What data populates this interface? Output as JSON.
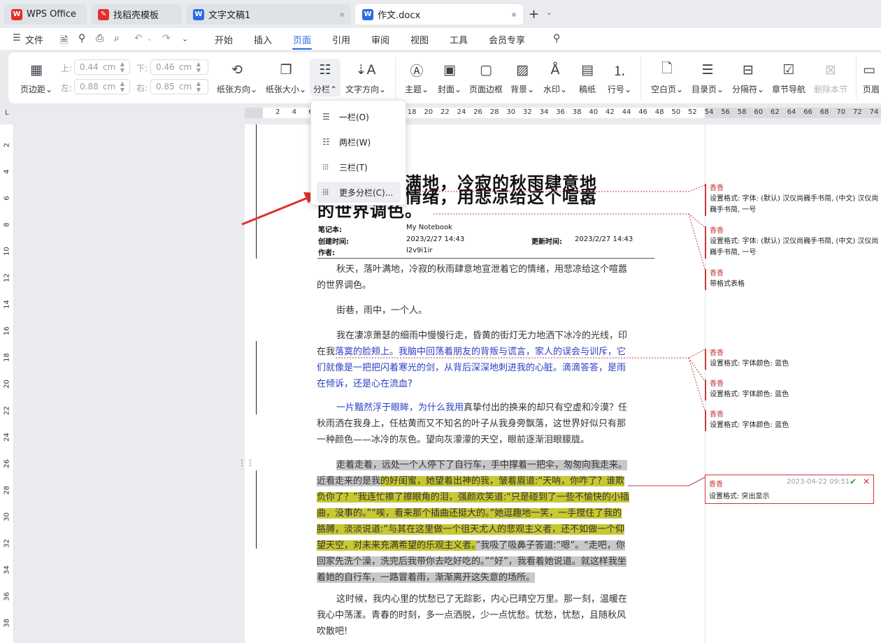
{
  "tabs": [
    {
      "label": "WPS Office",
      "icon": "wps-logo-icon",
      "color": "#e0302a"
    },
    {
      "label": "找稻壳模板",
      "icon": "docer-logo-icon",
      "color": "#e0302a"
    },
    {
      "label": "文字文稿1",
      "icon": "writer-doc-icon",
      "color": "#2b6be6"
    },
    {
      "label": "作文.docx",
      "icon": "writer-doc-icon",
      "color": "#2b6be6"
    }
  ],
  "menu": {
    "file": "文件",
    "items": [
      "开始",
      "插入",
      "页面",
      "引用",
      "审阅",
      "视图",
      "工具",
      "会员专享"
    ],
    "active": "页面"
  },
  "ribbon": {
    "margins": "页边距",
    "top_label": "上:",
    "top_value": "0.44",
    "bottom_label": "下:",
    "bottom_value": "0.46",
    "left_label": "左:",
    "left_value": "0.88",
    "right_label": "右:",
    "right_value": "0.85",
    "unit": "cm",
    "orientation": "纸张方向",
    "size": "纸张大小",
    "columns": "分栏",
    "text_direction": "文字方向",
    "theme": "主题",
    "cover": "封面",
    "border": "页面边框",
    "background": "背景",
    "watermark": "水印",
    "manuscript": "稿纸",
    "line_numbers": "行号",
    "blank_page": "空白页",
    "toc_page": "目录页",
    "separator": "分隔符",
    "section_nav": "章节导航",
    "delete_section": "删除本节",
    "header_footer": "页眉"
  },
  "ruler": {
    "h": [
      "2",
      "4",
      "6",
      "8",
      "10",
      "12",
      "14",
      "16",
      "18",
      "20",
      "22",
      "24",
      "26",
      "28",
      "30",
      "32",
      "34",
      "36",
      "38",
      "40",
      "42",
      "44",
      "46",
      "48",
      "50",
      "52",
      "54",
      "56",
      "58",
      "60",
      "62",
      "64",
      "66",
      "68",
      "70",
      "72",
      "74"
    ],
    "v": [
      "2",
      "4",
      "6",
      "8",
      "10",
      "12",
      "14",
      "16",
      "18",
      "20",
      "22",
      "24",
      "26",
      "28",
      "30",
      "32",
      "34",
      "36",
      "38"
    ]
  },
  "dropdown": {
    "items": [
      "一栏(O)",
      "两栏(W)",
      "三栏(T)",
      "更多分栏(C)..."
    ]
  },
  "doc": {
    "title_line1": "秋天，落叶满地，冷寂的秋雨肆意地",
    "title_line2": "宣泄着它的情绪，用悲凉给这个喧嚣",
    "title_line3": "的世界调色。",
    "meta": {
      "notebook_label": "笔记本:",
      "notebook": "My Notebook",
      "created_label": "创建时间:",
      "created": "2023/2/27 14:43",
      "updated_label": "更新时间:",
      "updated": "2023/2/27 14:43",
      "author_label": "作者:",
      "author": "l2v9i1ir"
    },
    "p1": "秋天，落叶满地，冷寂的秋雨肆意地宣泄着它的情绪，用悲凉给这个喧嚣的世界调色。",
    "p2": "街巷，雨中，一个人。",
    "p3a": "我在凄凉萧瑟的细雨中慢慢行走，昏黄的街灯无力地洒下冰冷的光线，印在我",
    "p3b": "落寞的脸颊上。我脑中回荡着朋友的背叛与谎言，家人的误会与训斥，它们就像是一把把闪着寒光的剑，从背后深深地刺进我的心脏。滴滴答答，是雨在倾诉，还是心在流血?",
    "p4a": "一片黯然浮于眼眸，为什么我用",
    "p4b": "真挚付出的换来的却只有空虚和冷漠？任秋雨洒在我身上，任枯黄而又不知名的叶子从我身旁飘落，这世界好似只有那一种颜色——冰冷的灰色。望向灰濛濛的天空，眼前逐渐泪眼朦胧。",
    "p5a": "走着走着，远处一个人停下了自行车，手中撑着一把伞，匆匆向我走来。近看走来的是我",
    "p5b": "的好闺蜜，她望着出神的我，皱着眉道:“天呐，你咋了？谁欺负你了？”我连忙擦了擦眼角的泪，强颜欢笑道:“只是碰到了一些不愉快的小插曲，没事的。”“唉，看来那个插曲还挺大的。”她逗趣地一笑，一手搅住了我的胳膊，淡淡说道:“与其在这里做一个徂天尤人的悲观主义者，还不如做一个仰望天空，对未来充满希望的乐观主义者。",
    "p5c": "”我吸了吸鼻子答道:“嗯”。“走吧，你回家先洗个澡，洗完后我带你去吃好吃的。”“好”，我看着她说道。就这样我坐着她的自行车，一路冒着雨，渐渐离开这失意的场所。",
    "p6": "这时候，我内心里的忧愁已了无踪影，内心已晴空万里。那一刻，温暖在我心中荡漾。青春的时刻，多一点洒脱，少一点忧愁。忧愁，忧愁，且随秋风吹散吧!"
  },
  "comments": [
    {
      "author": "香香",
      "text": "设置格式: 字体: (默认) 汉仪尚巍手书简, (中文) 汉仪尚巍手书简, 一号"
    },
    {
      "author": "香香",
      "text": "设置格式: 字体: (默认) 汉仪尚巍手书简, (中文) 汉仪尚巍手书简, 一号"
    },
    {
      "author": "香香",
      "text": "带格式表格"
    },
    {
      "author": "香香",
      "text": "设置格式: 字体颜色: 蓝色"
    },
    {
      "author": "香香",
      "text": "设置格式: 字体颜色: 蓝色"
    },
    {
      "author": "香香",
      "text": "设置格式: 字体颜色: 蓝色"
    },
    {
      "author": "香香",
      "text": "设置格式: 突出显示",
      "time": "2023-04-22 09:51"
    }
  ],
  "colors": {
    "accent": "#2b6be6",
    "revision": "#c53a3a",
    "inserted_text": "#2b3ec6",
    "highlight": "#c7c834",
    "arrow": "#e0302a"
  }
}
